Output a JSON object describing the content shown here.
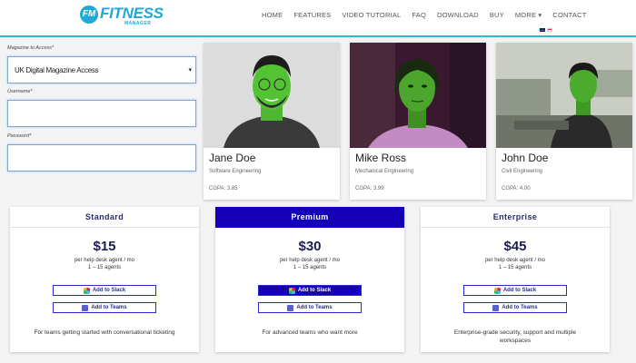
{
  "header": {
    "logo": {
      "mark": "FM",
      "name": "FITNESS",
      "sub": "MANAGER"
    },
    "nav": [
      "HOME",
      "FEATURES",
      "VIDEO TUTORIAL",
      "FAQ",
      "DOWNLOAD",
      "BUY",
      "MORE ▾",
      "CONTACT"
    ]
  },
  "form": {
    "magazine_label": "Magazine to Access*",
    "magazine_value": "UK Digital Magazine Access",
    "username_label": "Username*",
    "password_label": "Password*"
  },
  "profiles": [
    {
      "name": "Jane Doe",
      "role": "Software Engineering",
      "gpa": "CGPA: 3.85"
    },
    {
      "name": "Mike Ross",
      "role": "Mechanical Engineering",
      "gpa": "CGPA: 3.99"
    },
    {
      "name": "John Doe",
      "role": "Civil Engineering",
      "gpa": "CGPA: 4.00"
    }
  ],
  "pricing": [
    {
      "plan": "Standard",
      "price": "$15",
      "unit": "per help desk agent / mo",
      "agents": "1 – 15 agents",
      "slack": "Add to Slack",
      "teams": "Add to Teams",
      "desc": "For teams getting started with conversational ticketing"
    },
    {
      "plan": "Premium",
      "price": "$30",
      "unit": "per help desk agent / mo",
      "agents": "1 – 15 agents",
      "slack": "Add to Slack",
      "teams": "Add to Teams",
      "desc": "For advanced teams who want more"
    },
    {
      "plan": "Enterprise",
      "price": "$45",
      "unit": "per help desk agent / mo",
      "agents": "1 – 15 agents",
      "slack": "Add to Slack",
      "teams": "Add to Teams",
      "desc": "Enterprise-grade security, support and multiple workspaces"
    }
  ],
  "colors": {
    "brand": "#1fa9d4",
    "premium": "#1500b8"
  }
}
